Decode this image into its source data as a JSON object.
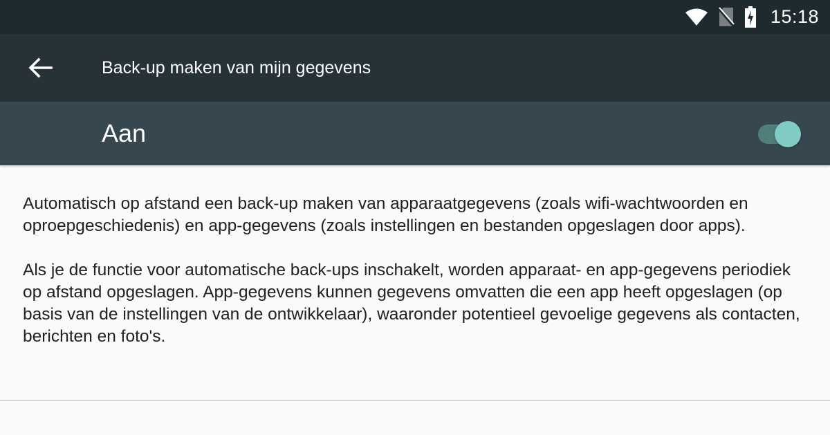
{
  "status_bar": {
    "time": "15:18",
    "icons": [
      "wifi-icon",
      "no-sim-icon",
      "battery-charging-icon"
    ]
  },
  "toolbar": {
    "back_icon": "arrow-back-icon",
    "title": "Back-up maken van mijn gegevens"
  },
  "master_switch": {
    "label": "Aan",
    "checked": true,
    "accent_color": "#80cbc4"
  },
  "description": {
    "paragraph_1": "Automatisch op afstand een back-up maken van apparaatgegevens (zoals wifi-wachtwoorden en oproepgeschiedenis) en app-gegevens (zoals instellingen en bestanden opgeslagen door apps).",
    "paragraph_2": "Als je de functie voor automatische back-ups inschakelt, worden apparaat- en app-gegevens periodiek op afstand opgeslagen. App-gegevens kunnen gegevens omvatten die een app heeft opgeslagen (op basis van de instellingen van de ontwikkelaar), waaronder potentieel gevoelige gegevens als contacten, berichten en foto's."
  },
  "colors": {
    "status_bar": "#1f2a2f",
    "toolbar": "#263238",
    "switch_bar": "#37474f",
    "background": "#fafafa"
  }
}
